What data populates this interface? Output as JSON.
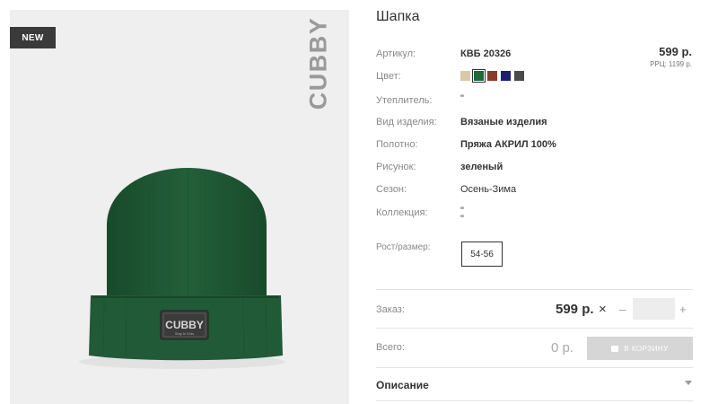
{
  "badge": "NEW",
  "brand_watermark": "CUBBY",
  "hat_label": {
    "brand": "CUBBY",
    "sub": "Stay In Kids"
  },
  "product": {
    "title": "Шапка",
    "price": "599 р.",
    "rrp_label": "РРЦ:",
    "rrp_value": "1199 р."
  },
  "attributes": [
    {
      "label": "Артикул:",
      "value": "КВБ 20326"
    },
    {
      "label": "Цвет:"
    },
    {
      "label": "Утеплитель:",
      "value": "\""
    },
    {
      "label": "Вид изделия:",
      "value": "Вязаные изделия"
    },
    {
      "label": "Полотно:",
      "value": "Пряжа АКРИЛ 100%"
    },
    {
      "label": "Рисунок:",
      "value": "зеленый"
    },
    {
      "label": "Сезон:",
      "value": "Осень-Зима"
    },
    {
      "label": "Коллекция:",
      "value": "\"",
      "value2": "\""
    }
  ],
  "colors": [
    {
      "name": "beige",
      "hex": "#d9c9a8"
    },
    {
      "name": "green",
      "hex": "#1e6a3a",
      "selected": true
    },
    {
      "name": "brown",
      "hex": "#8b3b2a"
    },
    {
      "name": "navy",
      "hex": "#1c1f73"
    },
    {
      "name": "dark-gray",
      "hex": "#4a4a4a"
    }
  ],
  "size": {
    "label": "Рост/размер:",
    "option": "54-56"
  },
  "order": {
    "label": "Заказ:",
    "price": "599 р.",
    "times": "×",
    "minus": "–",
    "plus": "+",
    "quantity": ""
  },
  "total": {
    "label": "Всего:",
    "value": "0 р."
  },
  "cart_button": "В КОРЗИНУ",
  "description": {
    "label": "Описание"
  },
  "theme": {
    "hat_color": "#1f5a35",
    "image_bg": "#efefef",
    "button_bg": "#d6d6d6"
  }
}
